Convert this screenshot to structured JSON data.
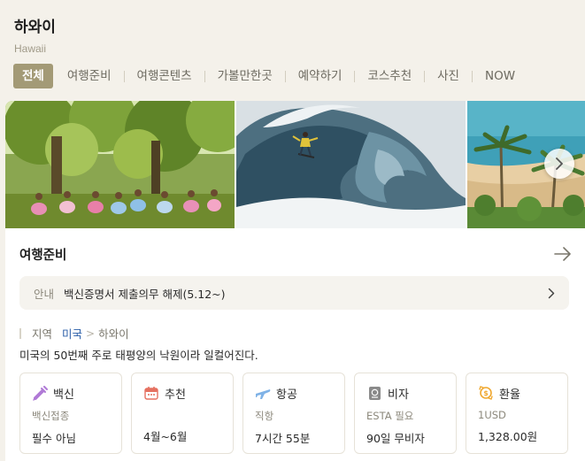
{
  "header": {
    "title": "하와이",
    "subtitle": "Hawaii"
  },
  "tabs": [
    {
      "label": "전체",
      "active": true
    },
    {
      "label": "여행준비"
    },
    {
      "label": "여행콘텐츠"
    },
    {
      "label": "가볼만한곳"
    },
    {
      "label": "예약하기"
    },
    {
      "label": "코스추천"
    },
    {
      "label": "사진"
    },
    {
      "label": "NOW"
    }
  ],
  "section": {
    "title": "여행준비"
  },
  "notice": {
    "label": "안내",
    "text": "백신증명서 제출의무 해제(5.12~)"
  },
  "region": {
    "label": "지역",
    "country": "미국",
    "current": "하와이"
  },
  "description": "미국의 50번째 주로 태평양의 낙원이라 일컬어진다.",
  "info_cards": [
    {
      "icon": "syringe-icon",
      "title": "백신",
      "sub": "백신접종",
      "value": "필수 아님",
      "color": "#b07ad6"
    },
    {
      "icon": "calendar-icon",
      "title": "추천",
      "sub": "",
      "value": "4월~6월",
      "color": "#e57060"
    },
    {
      "icon": "airplane-icon",
      "title": "항공",
      "sub": "직항",
      "value": "7시간 55분",
      "color": "#7fb2e6"
    },
    {
      "icon": "passport-icon",
      "title": "비자",
      "sub": "ESTA 필요",
      "value": "90일 무비자",
      "color": "#8a8a8a"
    },
    {
      "icon": "exchange-icon",
      "title": "환율",
      "sub": "1USD",
      "value": "1,328.00원",
      "color": "#f0a830"
    }
  ],
  "colors": {
    "accent": "#a39a76",
    "link": "#2a5ea8"
  }
}
